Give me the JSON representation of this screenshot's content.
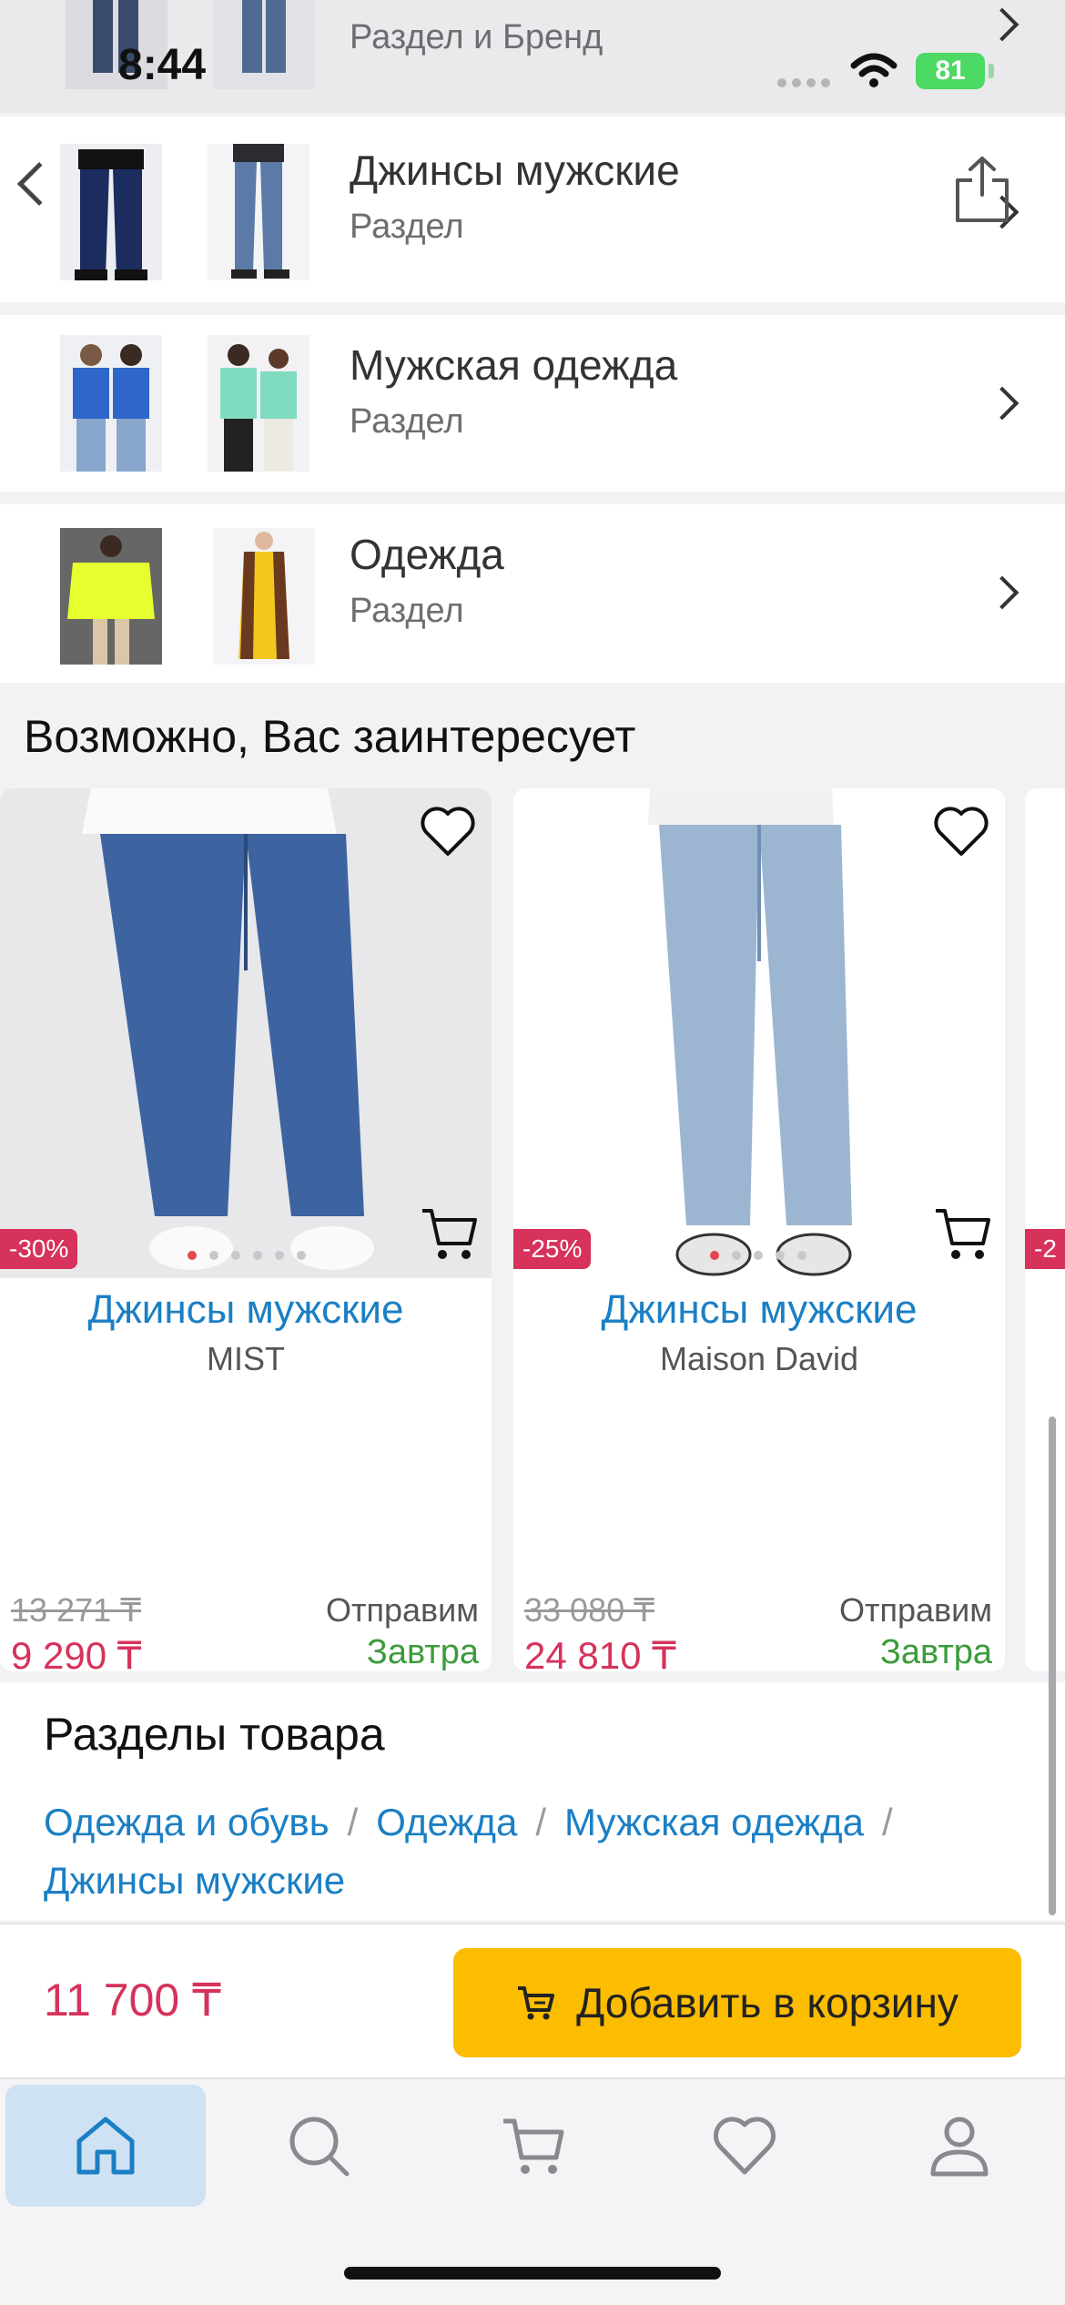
{
  "status_bar": {
    "time": "8:44",
    "battery": "81"
  },
  "sections_list": [
    {
      "title": "",
      "subtitle": "Раздел и Бренд"
    },
    {
      "title": "Джинсы мужские",
      "subtitle": "Раздел"
    },
    {
      "title": "Мужская одежда",
      "subtitle": "Раздел"
    },
    {
      "title": "Одежда",
      "subtitle": "Раздел"
    }
  ],
  "recommendations": {
    "title": "Возможно, Вас заинтересует",
    "products": [
      {
        "name": "Джинсы мужские",
        "brand": "MIST",
        "discount": "-30%",
        "old_price": "13 271 ₸",
        "price": "9 290 ₸",
        "shipping": "Отправим",
        "shipping_day": "Завтра"
      },
      {
        "name": "Джинсы мужские",
        "brand": "Maison David",
        "discount": "-25%",
        "old_price": "33 080 ₸",
        "price": "24 810 ₸",
        "shipping": "Отправим",
        "shipping_day": "Завтра"
      }
    ],
    "peek_discount": "-2"
  },
  "product_sections": {
    "title": "Разделы товара",
    "crumbs": [
      "Одежда и обувь",
      "Одежда",
      "Мужская одежда",
      "Джинсы мужские"
    ],
    "separator": "/"
  },
  "buy_bar": {
    "price": "11 700 ₸",
    "add_label": "Добавить в корзину"
  },
  "colors": {
    "accent": "#1b7fc4",
    "price": "#d6325b",
    "button": "#fcbc00",
    "ship_day": "#3b9b3b"
  },
  "tabs": [
    {
      "icon": "home-icon",
      "active": true
    },
    {
      "icon": "search-icon",
      "active": false
    },
    {
      "icon": "cart-icon",
      "active": false
    },
    {
      "icon": "heart-icon",
      "active": false
    },
    {
      "icon": "profile-icon",
      "active": false
    }
  ]
}
